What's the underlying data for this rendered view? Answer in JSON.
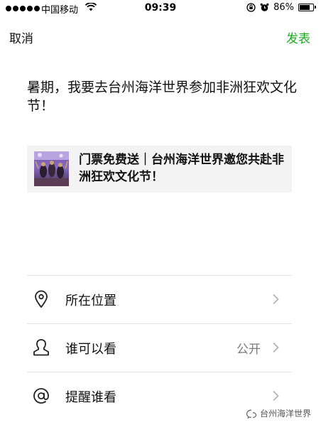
{
  "status_bar": {
    "carrier": "中国移动",
    "time": "09:39",
    "battery": "86%",
    "battery_level": 0.86
  },
  "nav": {
    "cancel_label": "取消",
    "publish_label": "发表",
    "publish_color": "#1aad19"
  },
  "post": {
    "text": "暑期，我要去台州海洋世界参加非洲狂欢文化节！"
  },
  "link_card": {
    "title": "门票免费送｜台州海洋世界邀您共赴非洲狂欢文化节！",
    "thumbnail_icon": "event-photo-thumbnail"
  },
  "options": [
    {
      "icon": "location-pin-icon",
      "label": "所在位置",
      "value": ""
    },
    {
      "icon": "person-icon",
      "label": "谁可以看",
      "value": "公开"
    },
    {
      "icon": "at-sign-icon",
      "label": "提醒谁看",
      "value": ""
    }
  ],
  "watermark": {
    "text": "台州海洋世界",
    "icon": "wechat-official-account-icon"
  }
}
